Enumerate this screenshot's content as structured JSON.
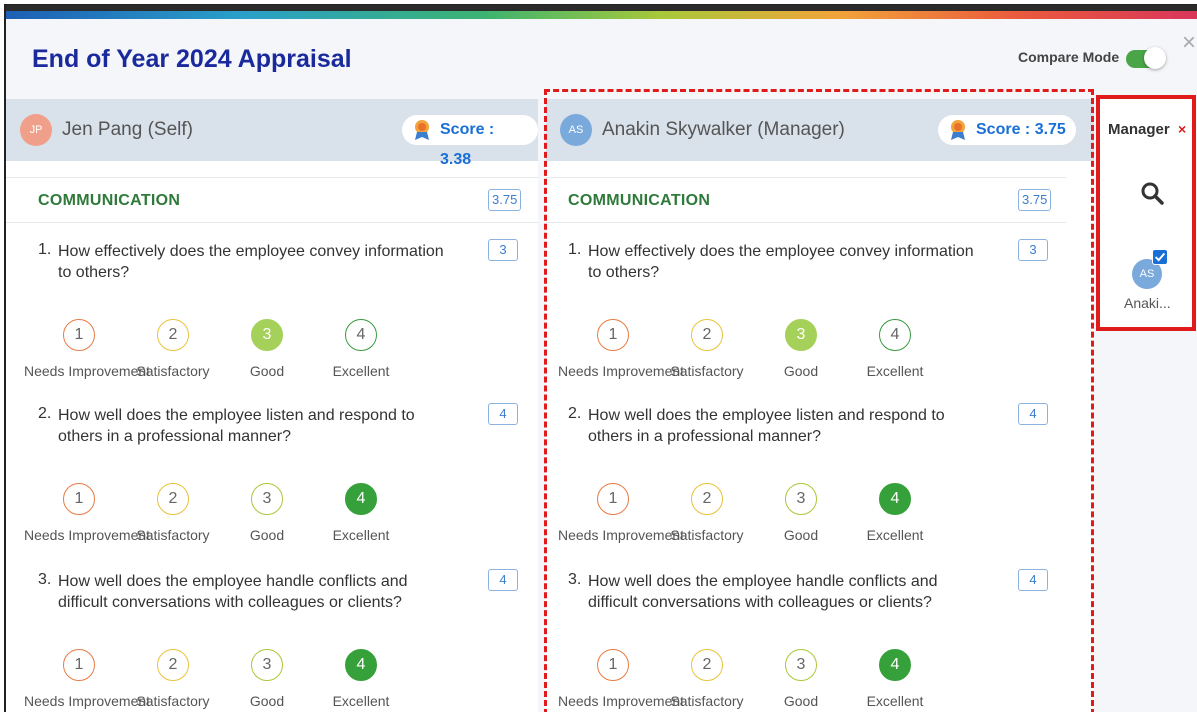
{
  "header": {
    "title": "End of Year 2024 Appraisal",
    "compare_mode_label": "Compare Mode",
    "compare_mode_on": true,
    "close_icon": "close-icon"
  },
  "colors": {
    "title": "#1a2a9c",
    "section": "#2f7a3a",
    "score": "#1a6fd6",
    "selected_good": "#a5d15a",
    "selected_excellent": "#36a13a",
    "highlight_box": "#e01b1b"
  },
  "columns": [
    {
      "initials": "JP",
      "name": "Jen Pang (Self)",
      "score_label": "Score : 3.38",
      "section_title": "COMMUNICATION",
      "section_score": "3.75",
      "questions": [
        {
          "num": "1.",
          "text": "How effectively does the employee convey information to others?",
          "score": "3",
          "selected": 3
        },
        {
          "num": "2.",
          "text": "How well does the employee listen and respond to others in a professional manner?",
          "score": "4",
          "selected": 4
        },
        {
          "num": "3.",
          "text": "How well does the employee handle conflicts and difficult conversations with colleagues or clients?",
          "score": "4",
          "selected": 4
        }
      ]
    },
    {
      "initials": "AS",
      "name": "Anakin Skywalker (Manager)",
      "score_label": "Score : 3.75",
      "section_title": "COMMUNICATION",
      "section_score": "3.75",
      "questions": [
        {
          "num": "1.",
          "text": "How effectively does the employee convey information to others?",
          "score": "3",
          "selected": 3
        },
        {
          "num": "2.",
          "text": "How well does the employee listen and respond to others in a professional manner?",
          "score": "4",
          "selected": 4
        },
        {
          "num": "3.",
          "text": "How well does the employee handle conflicts and difficult conversations with colleagues or clients?",
          "score": "4",
          "selected": 4
        }
      ]
    }
  ],
  "rating_options": [
    {
      "value": "1",
      "label": "Needs Improvement"
    },
    {
      "value": "2",
      "label": "Satisfactory"
    },
    {
      "value": "3",
      "label": "Good"
    },
    {
      "value": "4",
      "label": "Excellent"
    }
  ],
  "sidebar": {
    "title": "Manager",
    "remove_label": "×",
    "search_icon": "search-icon",
    "selected_initials": "AS",
    "selected_name": "Anaki..."
  }
}
